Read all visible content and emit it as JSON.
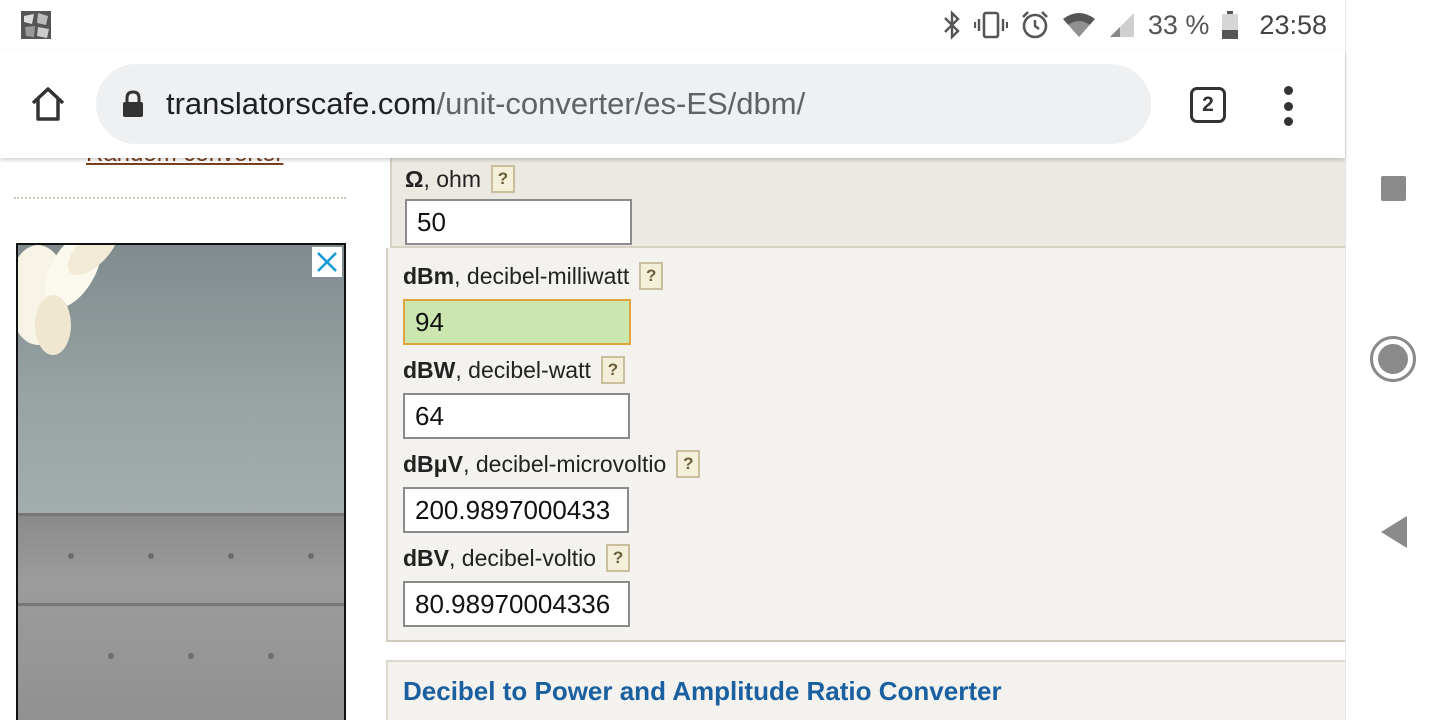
{
  "status_bar": {
    "app_icon": "app-notification-icon",
    "icons": [
      "bluetooth-icon",
      "vibrate-icon",
      "alarm-icon",
      "wifi-icon",
      "signal-icon"
    ],
    "battery_percent": "33 %",
    "battery_icon": "battery-icon",
    "time": "23:58"
  },
  "browser": {
    "url_host": "translatorscafe.com",
    "url_path": "/unit-converter/es-ES/dbm/",
    "tab_count": "2"
  },
  "sidebar": {
    "random_link": "Random converter"
  },
  "converter": {
    "ohm": {
      "symbol": "Ω",
      "name": ", ohm",
      "help": "?",
      "value": "50"
    },
    "dbm": {
      "symbol": "dBm",
      "name": ", decibel-milliwatt",
      "help": "?",
      "value": "94"
    },
    "dbw": {
      "symbol": "dBW",
      "name": ", decibel-watt",
      "help": "?",
      "value": "64"
    },
    "dbuv": {
      "symbol": "dBμV",
      "name": ", decibel-microvoltio",
      "help": "?",
      "value": "200.9897000433"
    },
    "dbv": {
      "symbol": "dBV",
      "name": ", decibel-voltio",
      "help": "?",
      "value": "80.98970004336"
    }
  },
  "next_section": {
    "title": "Decibel to Power and Amplitude Ratio Converter"
  },
  "colors": {
    "active_input_bg": "#cce6b0",
    "active_input_border": "#e0a43a",
    "section_title": "#1a5fa0",
    "link": "#7a3f1e"
  }
}
